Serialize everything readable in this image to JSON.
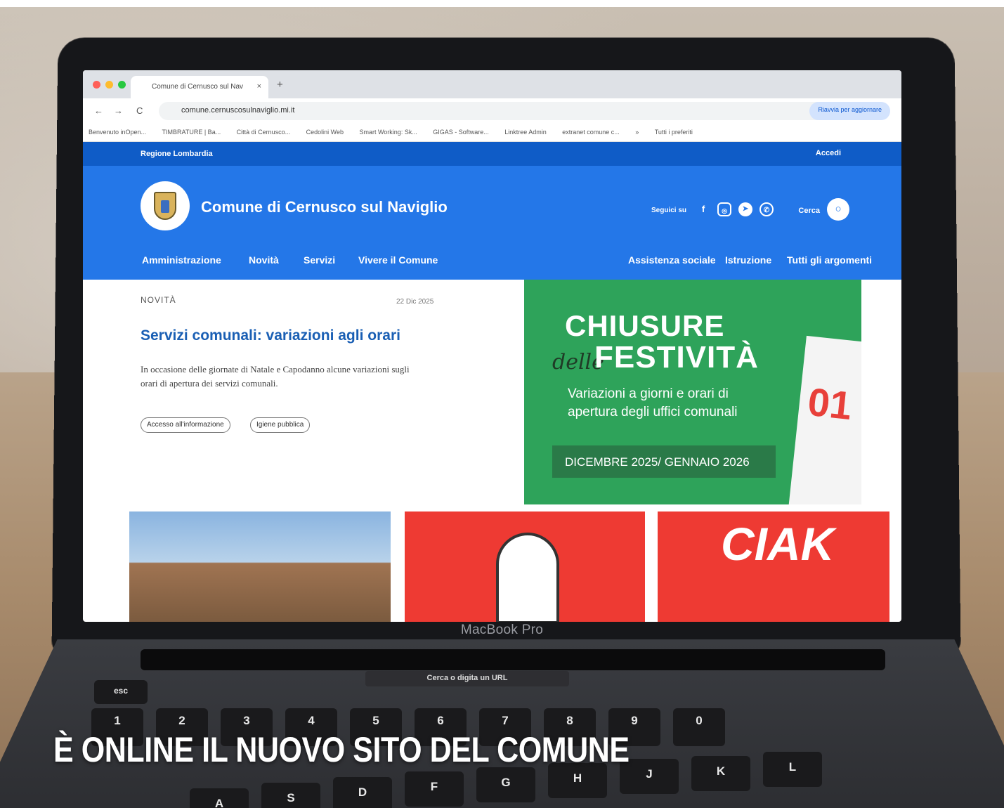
{
  "browser": {
    "tab_title": "Comune di Cernusco sul Nav",
    "tab_close": "×",
    "new_tab": "+",
    "back": "←",
    "forward": "→",
    "reload": "C",
    "url": "comune.cernuscosulnaviglio.mi.it",
    "update_button": "Riavvia per aggiornare",
    "bookmarks": [
      "Benvenuto inOpen...",
      "TIMBRATURE | Ba...",
      "Città di Cernusco...",
      "Cedolini Web",
      "Smart Working: Sk...",
      "GIGAS - Software...",
      "Linktree Admin",
      "extranet comune c...",
      "»",
      "Tutti i preferiti"
    ]
  },
  "site": {
    "region": "Regione Lombardia",
    "login": "Accedi",
    "title": "Comune di Cernusco sul Naviglio",
    "follow_label": "Seguici su",
    "search_label": "Cerca",
    "nav_left": [
      "Amministrazione",
      "Novità",
      "Servizi",
      "Vivere il Comune"
    ],
    "nav_right": [
      "Assistenza sociale",
      "Istruzione",
      "Tutti gli argomenti"
    ]
  },
  "news": {
    "kicker": "NOVITÀ",
    "date": "22 Dic 2025",
    "title": "Servizi comunali: variazioni agli orari",
    "text": "In occasione delle giornate di Natale e Capodanno alcune variazioni sugli orari di apertura dei servizi comunali.",
    "tags": [
      "Accesso all'informazione",
      "Igiene pubblica"
    ]
  },
  "banner": {
    "line1": "CHIUSURE",
    "script": "delle",
    "line2": "FESTIVITÀ",
    "subtitle": "Variazioni a giorni e orari di apertura degli uffici comunali",
    "dates": "DICEMBRE 2025/ GENNAIO 2026",
    "calendar_number": "01"
  },
  "thumbs": {
    "ciak_text": "CIAK"
  },
  "laptop": {
    "brand": "MacBook Pro",
    "touchbar_search": "Cerca o digita un URL",
    "key_labels": [
      "esc",
      "1",
      "2",
      "3",
      "4",
      "5",
      "6",
      "7",
      "8",
      "9",
      "0",
      "A",
      "S",
      "D",
      "F",
      "G",
      "H",
      "J",
      "K",
      "L"
    ]
  },
  "caption": "È ONLINE IL NUOVO SITO DEL COMUNE",
  "colors": {
    "site_blue": "#2477e8",
    "region_blue": "#0f5cc7",
    "banner_green": "#2ea35a",
    "thumb_red": "#ee3a33"
  }
}
